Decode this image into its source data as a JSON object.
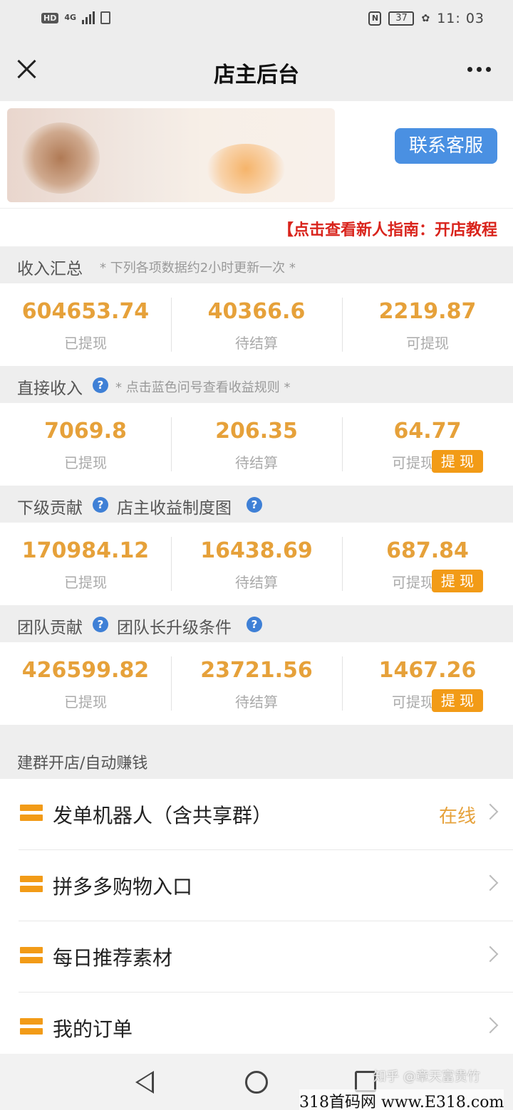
{
  "status_bar": {
    "hd": "HD",
    "network": "4G",
    "nfc": "N",
    "battery": "37",
    "time": "11: 03"
  },
  "header": {
    "title": "店主后台"
  },
  "profile": {
    "contact_label": "联系客服",
    "guide_text": "【点击查看新人指南：开店教程"
  },
  "income_summary": {
    "title": "收入汇总",
    "note": "* 下列各项数据约2小时更新一次 *",
    "withdrawn": "604653.74",
    "withdrawn_label": "已提现",
    "pending": "40366.6",
    "pending_label": "待结算",
    "available": "2219.87",
    "available_label": "可提现"
  },
  "direct_income": {
    "title": "直接收入",
    "note": "* 点击蓝色问号查看收益规则 *",
    "withdrawn": "7069.8",
    "withdrawn_label": "已提现",
    "pending": "206.35",
    "pending_label": "待结算",
    "available": "64.77",
    "available_label": "可提现",
    "withdraw_button": "提 现"
  },
  "sub_contribution": {
    "title": "下级贡献",
    "link": "店主收益制度图",
    "withdrawn": "170984.12",
    "withdrawn_label": "已提现",
    "pending": "16438.69",
    "pending_label": "待结算",
    "available": "687.84",
    "available_label": "可提现",
    "withdraw_button": "提 现"
  },
  "team_contribution": {
    "title": "团队贡献",
    "link": "团队长升级条件",
    "withdrawn": "426599.82",
    "withdrawn_label": "已提现",
    "pending": "23721.56",
    "pending_label": "待结算",
    "available": "1467.26",
    "available_label": "可提现",
    "withdraw_button": "提 现"
  },
  "menu": {
    "group_title": "建群开店/自动赚钱",
    "items": [
      {
        "label": "发单机器人（含共享群）",
        "status": "在线"
      },
      {
        "label": "拼多多购物入口",
        "status": ""
      },
      {
        "label": "每日推荐素材",
        "status": ""
      },
      {
        "label": "我的订单",
        "status": ""
      }
    ]
  },
  "watermark": {
    "zhihu": "知乎 @章天富贵竹",
    "site": "318首码网 www.E318.com"
  },
  "colors": {
    "accent_orange": "#f29b17",
    "number_gold": "#e6a13a",
    "contact_blue": "#4a90e2",
    "guide_red": "#d9241c"
  }
}
